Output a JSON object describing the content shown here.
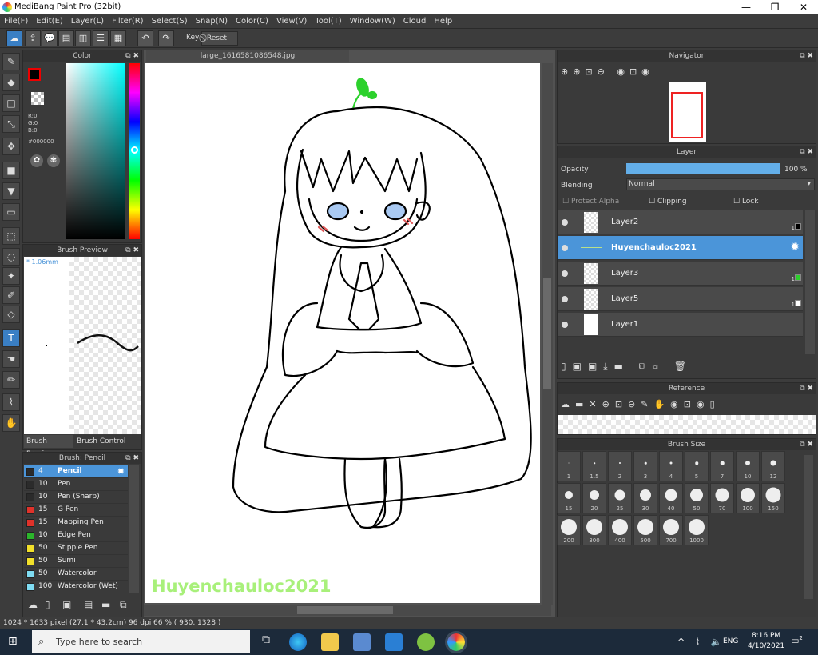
{
  "app": {
    "title": "MediBang Paint Pro (32bit)"
  },
  "menu": [
    "File(F)",
    "Edit(E)",
    "Layer(L)",
    "Filter(R)",
    "Select(S)",
    "Snap(N)",
    "Color(C)",
    "View(V)",
    "Tool(T)",
    "Window(W)",
    "Cloud",
    "Help"
  ],
  "toolbar": {
    "key_label": "Key",
    "reset_label": "Reset"
  },
  "color_panel": {
    "title": "Color",
    "r": "R:0",
    "g": "G:0",
    "b": "B:0",
    "hex": "#000000"
  },
  "brush_preview": {
    "title": "Brush Preview",
    "size": "* 1.06mm",
    "tab1": "Brush Preview",
    "tab2": "Brush Control"
  },
  "brush_panel": {
    "title": "Brush: Pencil",
    "items": [
      {
        "size": "4",
        "name": "Pencil",
        "color": "#2b2b2b"
      },
      {
        "size": "10",
        "name": "Pen",
        "color": "#2b2b2b"
      },
      {
        "size": "10",
        "name": "Pen (Sharp)",
        "color": "#2b2b2b"
      },
      {
        "size": "15",
        "name": "G Pen",
        "color": "#e0322a"
      },
      {
        "size": "15",
        "name": "Mapping Pen",
        "color": "#e0322a"
      },
      {
        "size": "10",
        "name": "Edge Pen",
        "color": "#2bb52b"
      },
      {
        "size": "50",
        "name": "Stipple Pen",
        "color": "#f2e02a"
      },
      {
        "size": "50",
        "name": "Sumi",
        "color": "#f2e02a"
      },
      {
        "size": "50",
        "name": "Watercolor",
        "color": "#7fdcf2"
      },
      {
        "size": "100",
        "name": "Watercolor (Wet)",
        "color": "#7fdcf2"
      }
    ]
  },
  "canvas": {
    "tab": "large_1616581086548.jpg",
    "signature": "Huyenchauloc2021"
  },
  "navigator": {
    "title": "Navigator"
  },
  "layer_panel": {
    "title": "Layer",
    "opacity_label": "Opacity",
    "opacity_value": "100 %",
    "opacity": 1.0,
    "blending_label": "Blending",
    "blending_value": "Normal",
    "protect_alpha": "Protect Alpha",
    "clipping": "Clipping",
    "lock": "Lock",
    "layers": [
      {
        "name": "Layer2",
        "badge": "1"
      },
      {
        "name": "Huyenchauloc2021",
        "badge": ""
      },
      {
        "name": "Layer3",
        "badge": "1"
      },
      {
        "name": "Layer5",
        "badge": "1"
      },
      {
        "name": "Layer1",
        "badge": ""
      }
    ]
  },
  "reference": {
    "title": "Reference"
  },
  "brush_size": {
    "title": "Brush Size",
    "sizes": [
      "1",
      "1.5",
      "2",
      "3",
      "4",
      "5",
      "7",
      "10",
      "12",
      "15",
      "20",
      "25",
      "30",
      "40",
      "50",
      "70",
      "100",
      "150",
      "200",
      "300",
      "400",
      "500",
      "700",
      "1000"
    ]
  },
  "status": {
    "text": "1024 * 1633 pixel  (27.1 * 43.2cm)  96 dpi  66 %  ( 930, 1328 )"
  },
  "taskbar": {
    "search_placeholder": "Type here to search",
    "lang": "ENG",
    "time": "8:16 PM",
    "date": "4/10/2021",
    "notif": "2"
  },
  "colors": {
    "accent": "#4b95d9",
    "signature": "#a8f07a"
  }
}
